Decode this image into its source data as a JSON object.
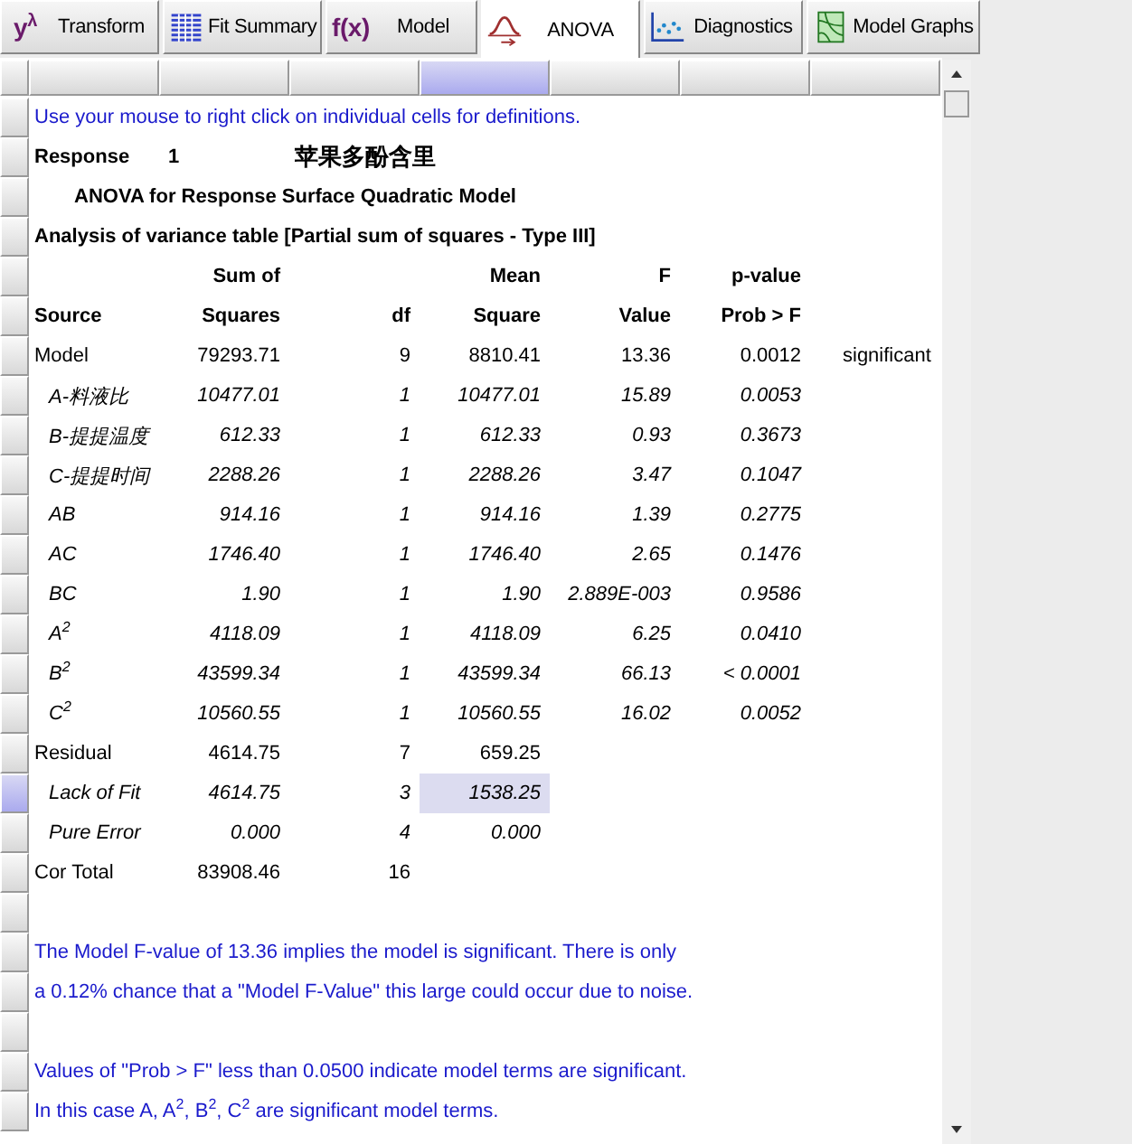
{
  "tabs": [
    {
      "label": "Transform",
      "glyph": "y$^{λ}$",
      "selected": false
    },
    {
      "label": "Fit Summary",
      "selected": false
    },
    {
      "label": "Model",
      "glyph": "f(x)",
      "selected": false
    },
    {
      "label": "ANOVA",
      "selected": true
    },
    {
      "label": "Diagnostics",
      "selected": false
    },
    {
      "label": "Model Graphs",
      "selected": false
    }
  ],
  "column_headers": [
    {
      "selected": false
    },
    {
      "selected": false
    },
    {
      "selected": false
    },
    {
      "selected": true
    },
    {
      "selected": false
    },
    {
      "selected": false
    },
    {
      "selected": false
    }
  ],
  "row_headers": [
    {
      "selected": false
    },
    {
      "selected": false
    },
    {
      "selected": false
    },
    {
      "selected": false
    },
    {
      "selected": false
    },
    {
      "selected": false
    },
    {
      "selected": false
    },
    {
      "selected": false
    },
    {
      "selected": false
    },
    {
      "selected": false
    },
    {
      "selected": false
    },
    {
      "selected": false
    },
    {
      "selected": false
    },
    {
      "selected": false
    },
    {
      "selected": false
    },
    {
      "selected": false
    },
    {
      "selected": false
    },
    {
      "selected": true
    },
    {
      "selected": false
    },
    {
      "selected": false
    },
    {
      "selected": false
    },
    {
      "selected": false
    },
    {
      "selected": false
    },
    {
      "selected": false
    },
    {
      "selected": false
    },
    {
      "selected": false
    }
  ],
  "report": {
    "intro": "Use your mouse to right click on individual cells for definitions.",
    "response_label": "Response",
    "response_number": "1",
    "response_name": "苹果多酚含里",
    "model_title": "ANOVA for Response Surface Quadratic Model",
    "table_title": "Analysis of variance table [Partial sum of squares - Type III]",
    "table": {
      "header_top": {
        "sum_sq": "Sum of",
        "mean_sq": "Mean",
        "f_value": "F",
        "p_value": "p-value"
      },
      "header": {
        "source": "Source",
        "sum_sq": "Squares",
        "df": "df",
        "mean_sq": "Square",
        "f_value": "Value",
        "p_value": "Prob > F"
      },
      "rows": [
        {
          "source": "Model",
          "sum_sq": "79293.71",
          "df": "9",
          "mean_sq": "8810.41",
          "f_value": "13.36",
          "p_value": "0.0012",
          "remark": "significant",
          "children": [
            {
              "source": "A-料液比",
              "sum_sq": "10477.01",
              "df": "1",
              "mean_sq": "10477.01",
              "f_value": "15.89",
              "p_value": "0.0053"
            },
            {
              "source": "B-提提温度",
              "sum_sq": "612.33",
              "df": "1",
              "mean_sq": "612.33",
              "f_value": "0.93",
              "p_value": "0.3673"
            },
            {
              "source": "C-提提时间",
              "sum_sq": "2288.26",
              "df": "1",
              "mean_sq": "2288.26",
              "f_value": "3.47",
              "p_value": "0.1047"
            },
            {
              "source": "AB",
              "sum_sq": "914.16",
              "df": "1",
              "mean_sq": "914.16",
              "f_value": "1.39",
              "p_value": "0.2775"
            },
            {
              "source": "AC",
              "sum_sq": "1746.40",
              "df": "1",
              "mean_sq": "1746.40",
              "f_value": "2.65",
              "p_value": "0.1476"
            },
            {
              "source": "BC",
              "sum_sq": "1.90",
              "df": "1",
              "mean_sq": "1.90",
              "f_value": "2.889E-003",
              "p_value": "0.9586"
            },
            {
              "source": "A$^{2}$",
              "sum_sq": "4118.09",
              "df": "1",
              "mean_sq": "4118.09",
              "f_value": "6.25",
              "p_value": "0.0410"
            },
            {
              "source": "B$^{2}$",
              "sum_sq": "43599.34",
              "df": "1",
              "mean_sq": "43599.34",
              "f_value": "66.13",
              "p_value": "< 0.0001"
            },
            {
              "source": "C$^{2}$",
              "sum_sq": "10560.55",
              "df": "1",
              "mean_sq": "10560.55",
              "f_value": "16.02",
              "p_value": "0.0052"
            }
          ]
        },
        {
          "source": "Residual",
          "sum_sq": "4614.75",
          "df": "7",
          "mean_sq": "659.25",
          "children": [
            {
              "source": "Lack of Fit",
              "sum_sq": "4614.75",
              "df": "3",
              "mean_sq": "1538.25"
            },
            {
              "source": "Pure Error",
              "sum_sq": "0.000",
              "df": "4",
              "mean_sq": "0.000"
            }
          ]
        },
        {
          "source": "Cor Total",
          "sum_sq": "83908.46",
          "df": "16"
        }
      ]
    },
    "notes": [
      [
        "The Model F-value of 13.36 implies the model is significant.  There is only",
        "a 0.12% chance that a \"Model F-Value\" this large could occur due to noise."
      ],
      [
        "Values of \"Prob > F\" less than 0.0500 indicate model terms are significant.",
        "In this case A, A$^{2}$, B$^{2}$, C$^{2}$ are significant model terms."
      ]
    ]
  }
}
